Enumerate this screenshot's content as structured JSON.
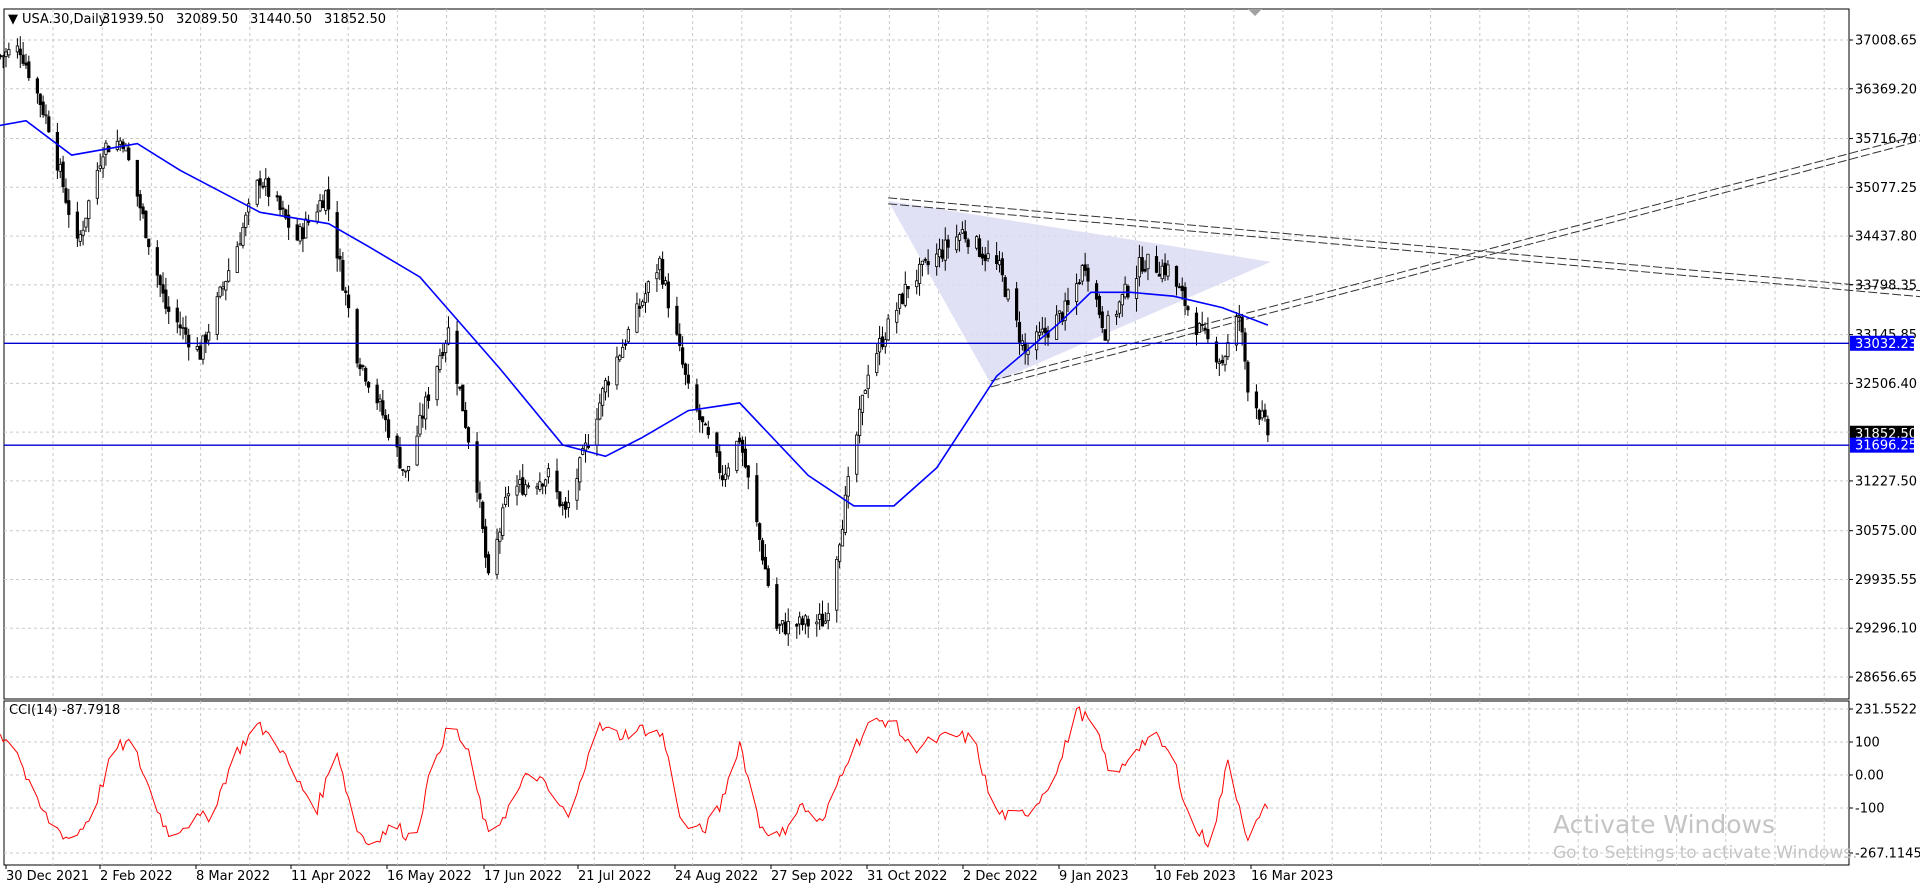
{
  "header": {
    "menu_glyph": "▼",
    "title": "USA.30,Daily",
    "ohlc": [
      "31939.50",
      "32089.50",
      "31440.50",
      "31852.50"
    ]
  },
  "indicator": {
    "label": "CCI(14) -87.7918"
  },
  "watermark": {
    "line1": "Activate Windows",
    "line2": "Go to Settings to activate Windows."
  },
  "colors": {
    "background": "#ffffff",
    "grid": "#c9c9c9",
    "candles": "#000000",
    "moving_average": "#0000ff",
    "support_lines": "#0000cc",
    "cci_line": "#ff0000",
    "triangle_fill": "#dcdcf4",
    "price_tag_blue": "#0000ff",
    "price_tag_black": "#000000",
    "watermark": "#c4c4c4"
  },
  "chart_data": [
    {
      "type": "candlestick",
      "title": "USA.30,Daily",
      "x_ticks": [
        "30 Dec 2021",
        "2 Feb 2022",
        "8 Mar 2022",
        "11 Apr 2022",
        "16 May 2022",
        "17 Jun 2022",
        "21 Jul 2022",
        "24 Aug 2022",
        "27 Sep 2022",
        "31 Oct 2022",
        "2 Dec 2022",
        "9 Jan 2023",
        "10 Feb 2023",
        "16 Mar 2023"
      ],
      "y_ticks": [
        "37008.65",
        "36369.20",
        "35716.70",
        "35077.25",
        "34437.80",
        "33798.35",
        "33145.85",
        "32506.40",
        "31227.50",
        "30575.00",
        "29935.55",
        "29296.10",
        "28656.65"
      ],
      "ylim": [
        28500,
        37300
      ],
      "grid": true,
      "price_tags": [
        {
          "label": "33032.23",
          "value": 33032.23,
          "style": "blue"
        },
        {
          "label": "31852.50",
          "value": 31852.5,
          "style": "black"
        },
        {
          "label": "31696.25",
          "value": 31696.25,
          "style": "blue"
        }
      ],
      "horizontal_lines": [
        33032.23,
        31696.25
      ],
      "close_path": [
        {
          "date": "2021-12-28",
          "close": 36800
        },
        {
          "date": "2022-01-04",
          "close": 36900
        },
        {
          "date": "2022-01-14",
          "close": 35900
        },
        {
          "date": "2022-01-24",
          "close": 34300
        },
        {
          "date": "2022-02-02",
          "close": 35600
        },
        {
          "date": "2022-02-09",
          "close": 35700
        },
        {
          "date": "2022-02-24",
          "close": 33500
        },
        {
          "date": "2022-03-08",
          "close": 32900
        },
        {
          "date": "2022-03-29",
          "close": 35200
        },
        {
          "date": "2022-04-11",
          "close": 34400
        },
        {
          "date": "2022-04-21",
          "close": 35000
        },
        {
          "date": "2022-05-02",
          "close": 32900
        },
        {
          "date": "2022-05-09",
          "close": 32300
        },
        {
          "date": "2022-05-19",
          "close": 31300
        },
        {
          "date": "2022-05-31",
          "close": 32900
        },
        {
          "date": "2022-06-03",
          "close": 33200
        },
        {
          "date": "2022-06-13",
          "close": 31200
        },
        {
          "date": "2022-06-17",
          "close": 29900
        },
        {
          "date": "2022-06-24",
          "close": 31100
        },
        {
          "date": "2022-07-01",
          "close": 31200
        },
        {
          "date": "2022-07-08",
          "close": 31300
        },
        {
          "date": "2022-07-14",
          "close": 30800
        },
        {
          "date": "2022-07-28",
          "close": 32500
        },
        {
          "date": "2022-08-16",
          "close": 34100
        },
        {
          "date": "2022-08-26",
          "close": 32400
        },
        {
          "date": "2022-09-07",
          "close": 31300
        },
        {
          "date": "2022-09-13",
          "close": 31800
        },
        {
          "date": "2022-09-26",
          "close": 29300
        },
        {
          "date": "2022-10-13",
          "close": 29400
        },
        {
          "date": "2022-10-28",
          "close": 32700
        },
        {
          "date": "2022-11-11",
          "close": 33800
        },
        {
          "date": "2022-11-30",
          "close": 34500
        },
        {
          "date": "2022-12-13",
          "close": 34000
        },
        {
          "date": "2022-12-22",
          "close": 32900
        },
        {
          "date": "2023-01-06",
          "close": 33500
        },
        {
          "date": "2023-01-12",
          "close": 34100
        },
        {
          "date": "2023-01-19",
          "close": 33200
        },
        {
          "date": "2023-02-01",
          "close": 34100
        },
        {
          "date": "2023-02-10",
          "close": 34000
        },
        {
          "date": "2023-02-21",
          "close": 33200
        },
        {
          "date": "2023-03-01",
          "close": 32800
        },
        {
          "date": "2023-03-07",
          "close": 33400
        },
        {
          "date": "2023-03-10",
          "close": 32500
        },
        {
          "date": "2023-03-17",
          "close": 31852.5
        }
      ],
      "moving_average": [
        {
          "date": "2021-12-15",
          "value": 35800
        },
        {
          "date": "2022-01-06",
          "value": 35950
        },
        {
          "date": "2022-01-22",
          "value": 35500
        },
        {
          "date": "2022-02-14",
          "value": 35650
        },
        {
          "date": "2022-03-01",
          "value": 35300
        },
        {
          "date": "2022-03-29",
          "value": 34750
        },
        {
          "date": "2022-04-22",
          "value": 34600
        },
        {
          "date": "2022-05-06",
          "value": 34300
        },
        {
          "date": "2022-05-24",
          "value": 33900
        },
        {
          "date": "2022-06-21",
          "value": 32700
        },
        {
          "date": "2022-07-13",
          "value": 31700
        },
        {
          "date": "2022-07-28",
          "value": 31550
        },
        {
          "date": "2022-08-10",
          "value": 31800
        },
        {
          "date": "2022-08-26",
          "value": 32150
        },
        {
          "date": "2022-09-13",
          "value": 32250
        },
        {
          "date": "2022-10-07",
          "value": 31300
        },
        {
          "date": "2022-10-23",
          "value": 30900
        },
        {
          "date": "2022-11-06",
          "value": 30900
        },
        {
          "date": "2022-11-21",
          "value": 31400
        },
        {
          "date": "2022-12-12",
          "value": 32600
        },
        {
          "date": "2023-01-03",
          "value": 33300
        },
        {
          "date": "2023-01-14",
          "value": 33700
        },
        {
          "date": "2023-01-28",
          "value": 33700
        },
        {
          "date": "2023-02-12",
          "value": 33650
        },
        {
          "date": "2023-03-01",
          "value": 33500
        },
        {
          "date": "2023-03-17",
          "value": 33270
        }
      ],
      "drawings": {
        "triangle": [
          {
            "date": "2022-11-04",
            "value": 34900
          },
          {
            "date": "2023-03-18",
            "value": 34100
          },
          {
            "date": "2022-12-10",
            "value": 32500
          }
        ],
        "descending_channel": [
          {
            "date": "2022-11-04",
            "value": 34900
          },
          {
            "date": "2024-03-08",
            "value": 33250
          }
        ],
        "ascending_channel": [
          {
            "date": "2022-12-10",
            "value": 32500
          },
          {
            "date": "2024-03-08",
            "value": 37000
          }
        ]
      }
    },
    {
      "type": "line",
      "title": "CCI(14) -87.7918",
      "y_ticks": [
        "231.5522",
        "100",
        "0.00",
        "-100",
        "-267.1145"
      ],
      "ylim": [
        -267.1145,
        231.5522
      ],
      "series": [
        {
          "name": "CCI(14)",
          "points": [
            {
              "date": "2021-12-28",
              "value": 120
            },
            {
              "date": "2022-01-02",
              "value": 100
            },
            {
              "date": "2022-01-08",
              "value": -60
            },
            {
              "date": "2022-01-15",
              "value": -150
            },
            {
              "date": "2022-01-22",
              "value": -200
            },
            {
              "date": "2022-01-29",
              "value": -120
            },
            {
              "date": "2022-02-06",
              "value": 80
            },
            {
              "date": "2022-02-12",
              "value": 100
            },
            {
              "date": "2022-02-19",
              "value": -60
            },
            {
              "date": "2022-02-25",
              "value": -180
            },
            {
              "date": "2022-03-05",
              "value": -140
            },
            {
              "date": "2022-03-12",
              "value": -120
            },
            {
              "date": "2022-03-20",
              "value": 60
            },
            {
              "date": "2022-03-28",
              "value": 150
            },
            {
              "date": "2022-04-04",
              "value": 100
            },
            {
              "date": "2022-04-11",
              "value": -20
            },
            {
              "date": "2022-04-18",
              "value": -100
            },
            {
              "date": "2022-04-25",
              "value": 80
            },
            {
              "date": "2022-05-01",
              "value": -150
            },
            {
              "date": "2022-05-06",
              "value": -210
            },
            {
              "date": "2022-05-15",
              "value": -150
            },
            {
              "date": "2022-05-22",
              "value": -200
            },
            {
              "date": "2022-05-29",
              "value": 50
            },
            {
              "date": "2022-06-04",
              "value": 160
            },
            {
              "date": "2022-06-10",
              "value": 60
            },
            {
              "date": "2022-06-17",
              "value": -190
            },
            {
              "date": "2022-06-24",
              "value": -100
            },
            {
              "date": "2022-07-02",
              "value": 20
            },
            {
              "date": "2022-07-09",
              "value": -60
            },
            {
              "date": "2022-07-16",
              "value": -140
            },
            {
              "date": "2022-07-24",
              "value": 150
            },
            {
              "date": "2022-08-02",
              "value": 120
            },
            {
              "date": "2022-08-10",
              "value": 140
            },
            {
              "date": "2022-08-17",
              "value": 120
            },
            {
              "date": "2022-08-24",
              "value": -150
            },
            {
              "date": "2022-08-31",
              "value": -170
            },
            {
              "date": "2022-09-06",
              "value": -100
            },
            {
              "date": "2022-09-13",
              "value": 100
            },
            {
              "date": "2022-09-20",
              "value": -150
            },
            {
              "date": "2022-09-27",
              "value": -190
            },
            {
              "date": "2022-10-04",
              "value": -90
            },
            {
              "date": "2022-10-12",
              "value": -150
            },
            {
              "date": "2022-10-20",
              "value": 40
            },
            {
              "date": "2022-10-28",
              "value": 150
            },
            {
              "date": "2022-11-05",
              "value": 170
            },
            {
              "date": "2022-11-12",
              "value": 80
            },
            {
              "date": "2022-11-19",
              "value": 100
            },
            {
              "date": "2022-11-26",
              "value": 120
            },
            {
              "date": "2022-12-04",
              "value": 110
            },
            {
              "date": "2022-12-11",
              "value": -110
            },
            {
              "date": "2022-12-18",
              "value": -130
            },
            {
              "date": "2022-12-25",
              "value": -100
            },
            {
              "date": "2023-01-03",
              "value": 30
            },
            {
              "date": "2023-01-09",
              "value": 200
            },
            {
              "date": "2023-01-15",
              "value": 150
            },
            {
              "date": "2023-01-22",
              "value": -20
            },
            {
              "date": "2023-01-29",
              "value": 80
            },
            {
              "date": "2023-02-05",
              "value": 120
            },
            {
              "date": "2023-02-12",
              "value": 50
            },
            {
              "date": "2023-02-18",
              "value": -150
            },
            {
              "date": "2023-02-25",
              "value": -210
            },
            {
              "date": "2023-03-03",
              "value": 40
            },
            {
              "date": "2023-03-10",
              "value": -190
            },
            {
              "date": "2023-03-15",
              "value": -120
            },
            {
              "date": "2023-03-17",
              "value": -87.79
            }
          ]
        }
      ]
    }
  ]
}
